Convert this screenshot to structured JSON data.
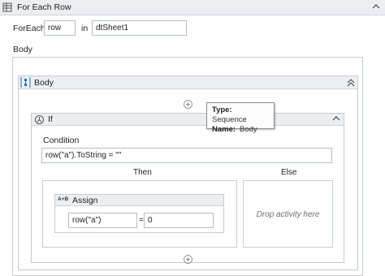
{
  "foreach": {
    "title": "For Each Row",
    "foreach_label": "ForEach",
    "item_value": "row",
    "in_label": "in",
    "collection_value": "dtSheet1",
    "body_label": "Body"
  },
  "sequence": {
    "title": "Body"
  },
  "tooltip": {
    "type_label": "Type:",
    "type_value": "Sequence",
    "name_label": "Name:",
    "name_value": "Body"
  },
  "if_activity": {
    "title": "If",
    "condition_label": "Condition",
    "condition_value": "row(\"a\").ToString = \"\"",
    "then_label": "Then",
    "else_label": "Else",
    "else_placeholder": "Drop activity here"
  },
  "assign": {
    "icon_text": "A+B",
    "title": "Assign",
    "to_value": "row(\"a\")",
    "equals": "=",
    "value": "0"
  }
}
